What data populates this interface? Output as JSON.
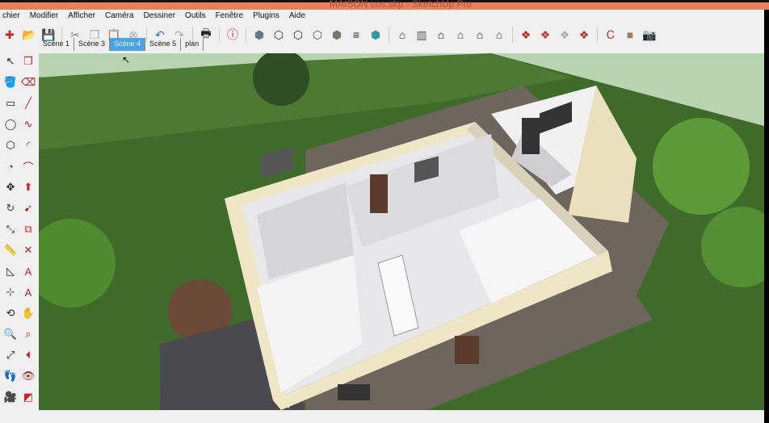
{
  "window": {
    "title": "MAISON cos.skp - SketchUp Pro"
  },
  "menu": [
    "chier",
    "Modifier",
    "Afficher",
    "Caméra",
    "Dessiner",
    "Outils",
    "Fenêtre",
    "Plugins",
    "Aide"
  ],
  "toolbar": [
    {
      "icon": "new-file-icon",
      "g": "✚",
      "c": "#c22"
    },
    {
      "icon": "open-folder-icon",
      "g": "📂",
      "c": "#585"
    },
    {
      "icon": "save-icon",
      "g": "💾",
      "c": "#357"
    },
    "|",
    {
      "icon": "cut-icon",
      "g": "✂",
      "c": "#888"
    },
    {
      "icon": "copy-icon",
      "g": "❐",
      "c": "#aaa"
    },
    {
      "icon": "paste-icon",
      "g": "📋",
      "c": "#aaa"
    },
    {
      "icon": "erase-icon",
      "g": "⊗",
      "c": "#aaa"
    },
    "|",
    {
      "icon": "undo-icon",
      "g": "↶",
      "c": "#27c"
    },
    {
      "icon": "redo-icon",
      "g": "↷",
      "c": "#aaa"
    },
    "|",
    {
      "icon": "print-icon",
      "g": "🖶",
      "c": "#222"
    },
    "|",
    {
      "icon": "model-info-icon",
      "g": "ⓘ",
      "c": "#c22"
    },
    "|",
    {
      "icon": "xray-icon",
      "g": "⬢",
      "c": "#678"
    },
    {
      "icon": "back-edges-icon",
      "g": "⬡",
      "c": "#333"
    },
    {
      "icon": "wireframe-icon",
      "g": "⬡",
      "c": "#333"
    },
    {
      "icon": "hidden-line-icon",
      "g": "⬡",
      "c": "#555"
    },
    {
      "icon": "shaded-icon",
      "g": "⬢",
      "c": "#776"
    },
    {
      "icon": "shaded-textures-icon",
      "g": "≡",
      "c": "#222"
    },
    {
      "icon": "monochrome-icon",
      "g": "⬢",
      "c": "#39a"
    },
    "|",
    {
      "icon": "iso-view-icon",
      "g": "⌂",
      "c": "#333"
    },
    {
      "icon": "top-view-icon",
      "g": "▥",
      "c": "#555"
    },
    {
      "icon": "front-view-icon",
      "g": "⌂",
      "c": "#111"
    },
    {
      "icon": "right-view-icon",
      "g": "⌂",
      "c": "#444"
    },
    {
      "icon": "back-view-icon",
      "g": "⌂",
      "c": "#222"
    },
    {
      "icon": "left-view-icon",
      "g": "⌂",
      "c": "#444"
    },
    "|",
    {
      "icon": "warehouse-icon",
      "g": "❖",
      "c": "#b22"
    },
    {
      "icon": "share-model-icon",
      "g": "❖",
      "c": "#b33"
    },
    {
      "icon": "share-component-icon",
      "g": "❖",
      "c": "#aaa"
    },
    {
      "icon": "extension-warehouse-icon",
      "g": "❖",
      "c": "#a32"
    },
    "|",
    {
      "icon": "layout-icon",
      "g": "Ꮯ",
      "c": "#c22"
    },
    {
      "icon": "material-icon",
      "g": "■",
      "c": "#a76"
    },
    {
      "icon": "photo-match-icon",
      "g": "📷",
      "c": "#c33"
    }
  ],
  "scenes": {
    "tabs": [
      "Scène 1",
      "Scène 3",
      "Scène 4",
      "Scène 5",
      "plan"
    ],
    "active": "Scène 4"
  },
  "lefttools": [
    {
      "icon": "select-icon",
      "g": "↖"
    },
    {
      "icon": "make-component-icon",
      "g": "❒"
    },
    {
      "icon": "paint-bucket-icon",
      "g": "🪣"
    },
    {
      "icon": "eraser-icon",
      "g": "⌫"
    },
    {
      "icon": "rectangle-icon",
      "g": "▭"
    },
    {
      "icon": "line-icon",
      "g": "╱"
    },
    {
      "icon": "circle-icon",
      "g": "◯"
    },
    {
      "icon": "freehand-icon",
      "g": "∿"
    },
    {
      "icon": "polygon-icon",
      "g": "⬡"
    },
    {
      "icon": "arc-icon",
      "g": "◜"
    },
    {
      "icon": "pie-icon",
      "g": "◔"
    },
    {
      "icon": "arc2-icon",
      "g": "⌒"
    },
    {
      "icon": "move-icon",
      "g": "✥"
    },
    {
      "icon": "push-pull-icon",
      "g": "⬆"
    },
    {
      "icon": "rotate-icon",
      "g": "↻"
    },
    {
      "icon": "follow-me-icon",
      "g": "➹"
    },
    {
      "icon": "scale-icon",
      "g": "⤡"
    },
    {
      "icon": "offset-icon",
      "g": "⧉"
    },
    {
      "icon": "tape-measure-icon",
      "g": "📏"
    },
    {
      "icon": "dimension-icon",
      "g": "✕"
    },
    {
      "icon": "protractor-icon",
      "g": "◺"
    },
    {
      "icon": "text-icon",
      "g": "A"
    },
    {
      "icon": "axes-icon",
      "g": "⊹"
    },
    {
      "icon": "3d-text-icon",
      "g": "A"
    },
    {
      "icon": "orbit-icon",
      "g": "⟲"
    },
    {
      "icon": "pan-icon",
      "g": "✋"
    },
    {
      "icon": "zoom-icon",
      "g": "🔍"
    },
    {
      "icon": "zoom-window-icon",
      "g": "⌕"
    },
    {
      "icon": "zoom-extents-icon",
      "g": "⤢"
    },
    {
      "icon": "previous-view-icon",
      "g": "⏴"
    },
    {
      "icon": "walk-icon",
      "g": "👣"
    },
    {
      "icon": "look-around-icon",
      "g": "👁"
    },
    {
      "icon": "position-camera-icon",
      "g": "🎥"
    },
    {
      "icon": "section-plane-icon",
      "g": "◩"
    }
  ],
  "colors": {
    "accent_tab": "#4aa3e8",
    "grass": "#3f6b2a",
    "wall": "#efe6c6",
    "gravel": "#6e655c"
  }
}
